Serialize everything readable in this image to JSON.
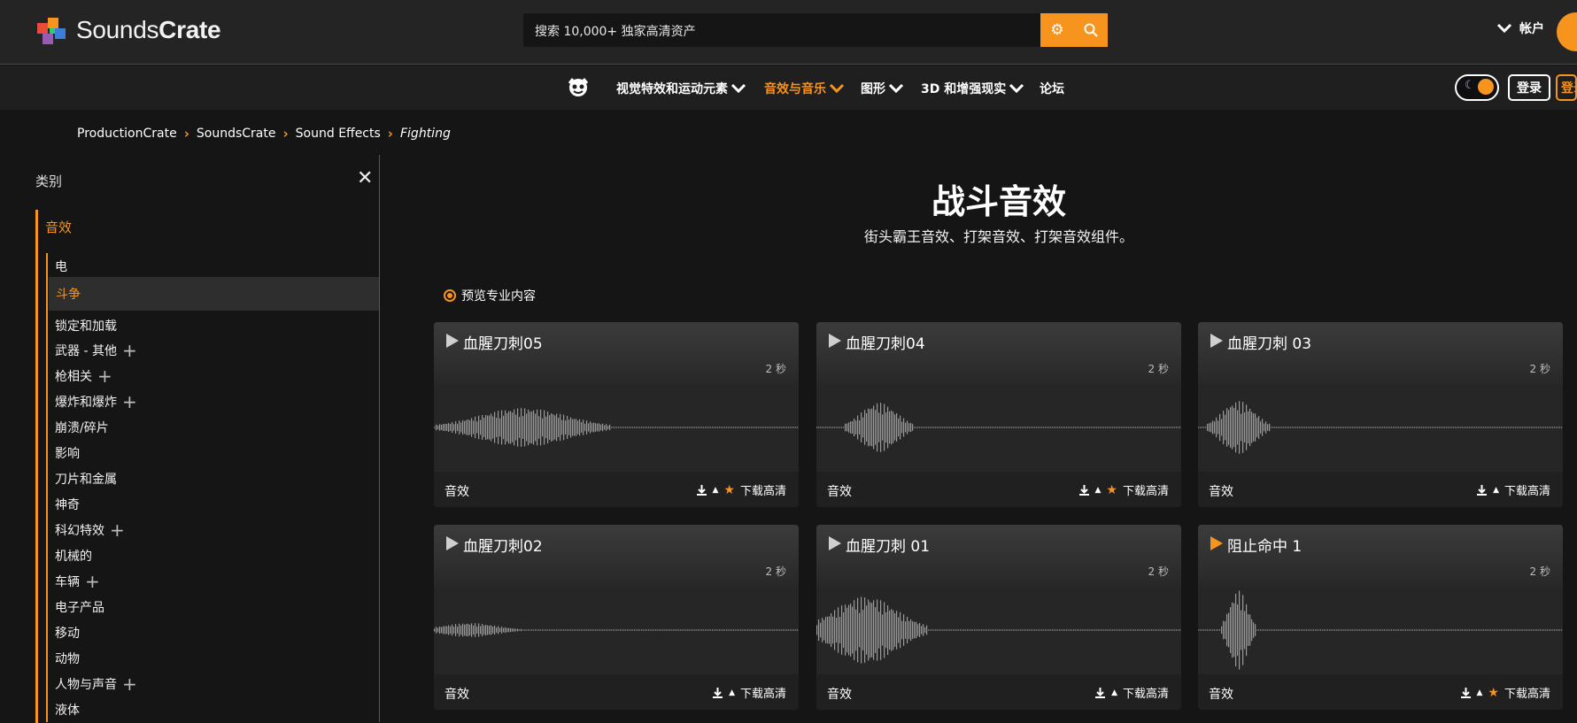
{
  "header": {
    "logo_light": "Sounds",
    "logo_bold": "Crate",
    "search_placeholder": "搜索 10,000+ 独家高清资产",
    "account_label": "帐户"
  },
  "nav": {
    "items": [
      {
        "label": "视觉特效和运动元素",
        "dropdown": true,
        "active": false
      },
      {
        "label": "音效与音乐",
        "dropdown": true,
        "active": true
      },
      {
        "label": "图形",
        "dropdown": true,
        "active": false
      },
      {
        "label": "3D 和增强现实",
        "dropdown": true,
        "active": false
      },
      {
        "label": "论坛",
        "dropdown": false,
        "active": false
      }
    ],
    "login_label": "登录",
    "login2_label": "登录"
  },
  "breadcrumb": {
    "items": [
      "ProductionCrate",
      "SoundsCrate",
      "Sound Effects"
    ],
    "current": "Fighting"
  },
  "sidebar": {
    "title": "类别",
    "category": "音效",
    "items": [
      {
        "label": "电",
        "expandable": false,
        "selected": false
      },
      {
        "label": "斗争",
        "expandable": false,
        "selected": true
      },
      {
        "label": "锁定和加载",
        "expandable": false,
        "selected": false
      },
      {
        "label": "武器 - 其他",
        "expandable": true,
        "selected": false
      },
      {
        "label": "枪相关",
        "expandable": true,
        "selected": false
      },
      {
        "label": "爆炸和爆炸",
        "expandable": true,
        "selected": false
      },
      {
        "label": "崩溃/碎片",
        "expandable": false,
        "selected": false
      },
      {
        "label": "影响",
        "expandable": false,
        "selected": false
      },
      {
        "label": "刀片和金属",
        "expandable": false,
        "selected": false
      },
      {
        "label": "神奇",
        "expandable": false,
        "selected": false
      },
      {
        "label": "科幻特效",
        "expandable": true,
        "selected": false
      },
      {
        "label": "机械的",
        "expandable": false,
        "selected": false
      },
      {
        "label": "车辆",
        "expandable": true,
        "selected": false
      },
      {
        "label": "电子产品",
        "expandable": false,
        "selected": false
      },
      {
        "label": "移动",
        "expandable": false,
        "selected": false
      },
      {
        "label": "动物",
        "expandable": false,
        "selected": false
      },
      {
        "label": "人物与声音",
        "expandable": true,
        "selected": false
      },
      {
        "label": "液体",
        "expandable": false,
        "selected": false
      }
    ]
  },
  "main": {
    "title": "战斗音效",
    "subtitle": "街头霸王音效、打架音效、打架音效组件。",
    "preview_label": "预览专业内容"
  },
  "cards": [
    {
      "title": "血腥刀刺05",
      "duration": "2 秒",
      "type": "音效",
      "hd_label": "下载高清",
      "star": true,
      "playing": false
    },
    {
      "title": "血腥刀刺04",
      "duration": "2 秒",
      "type": "音效",
      "hd_label": "下载高清",
      "star": true,
      "playing": false
    },
    {
      "title": "血腥刀刺 03",
      "duration": "2 秒",
      "type": "音效",
      "hd_label": "下载高清",
      "star": false,
      "playing": false
    },
    {
      "title": "血腥刀刺02",
      "duration": "2 秒",
      "type": "音效",
      "hd_label": "下载高清",
      "star": false,
      "playing": false
    },
    {
      "title": "血腥刀刺 01",
      "duration": "2 秒",
      "type": "音效",
      "hd_label": "下载高清",
      "star": false,
      "playing": false
    },
    {
      "title": "阻止命中 1",
      "duration": "2 秒",
      "type": "音效",
      "hd_label": "下载高清",
      "star": true,
      "playing": true
    }
  ],
  "colors": {
    "accent": "#f7941d",
    "background": "#151515",
    "header": "#242424"
  }
}
